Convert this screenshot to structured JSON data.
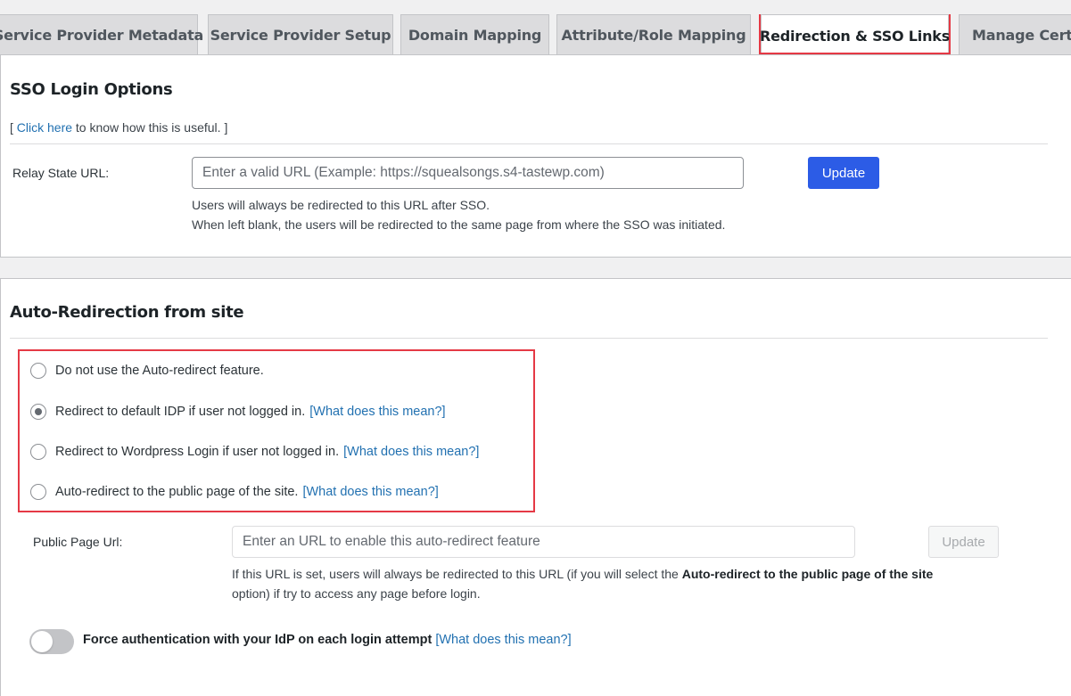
{
  "tabs": [
    {
      "label": "Service Provider Metadata"
    },
    {
      "label": "Service Provider Setup"
    },
    {
      "label": "Domain Mapping"
    },
    {
      "label": "Attribute/Role Mapping"
    },
    {
      "label": "Redirection & SSO Links",
      "active": true
    },
    {
      "label": "Manage Certif"
    }
  ],
  "sso_login": {
    "title": "SSO Login Options",
    "help_prefix": "[ ",
    "help_link": "Click here",
    "help_suffix": " to know how this is useful. ]",
    "relay_label": "Relay State URL:",
    "relay_placeholder": "Enter a valid URL (Example: https://squealsongs.s4-tastewp.com)",
    "update_label": "Update",
    "desc_line1": "Users will always be redirected to this URL after SSO.",
    "desc_line2": "When left blank, the users will be redirected to the same page from where the SSO was initiated."
  },
  "auto_redirect": {
    "title": "Auto-Redirection from site",
    "options": [
      {
        "label": "Do not use the Auto-redirect feature.",
        "link": "",
        "checked": false
      },
      {
        "label": "Redirect to default IDP if user not logged in.",
        "link": "[What does this mean?]",
        "checked": true
      },
      {
        "label": "Redirect to Wordpress Login if user not logged in.",
        "link": "[What does this mean?]",
        "checked": false
      },
      {
        "label": "Auto-redirect to the public page of the site.",
        "link": "[What does this mean?]",
        "checked": false
      }
    ],
    "public_label": "Public Page Url:",
    "public_placeholder": "Enter an URL to enable this auto-redirect feature",
    "update_label": "Update",
    "desc_part1": "If this URL is set, users will always be redirected to this URL (if you will select the ",
    "desc_bold": "Auto-redirect to the public page of the site",
    "desc_part2": " option) if try to access any page before login.",
    "force_label": "Force authentication with your IdP on each login attempt",
    "force_link": "[What does this mean?]",
    "force_enabled": false
  },
  "colors": {
    "accent": "#2c5ce6",
    "link": "#2271b1",
    "highlight": "#e53945"
  }
}
